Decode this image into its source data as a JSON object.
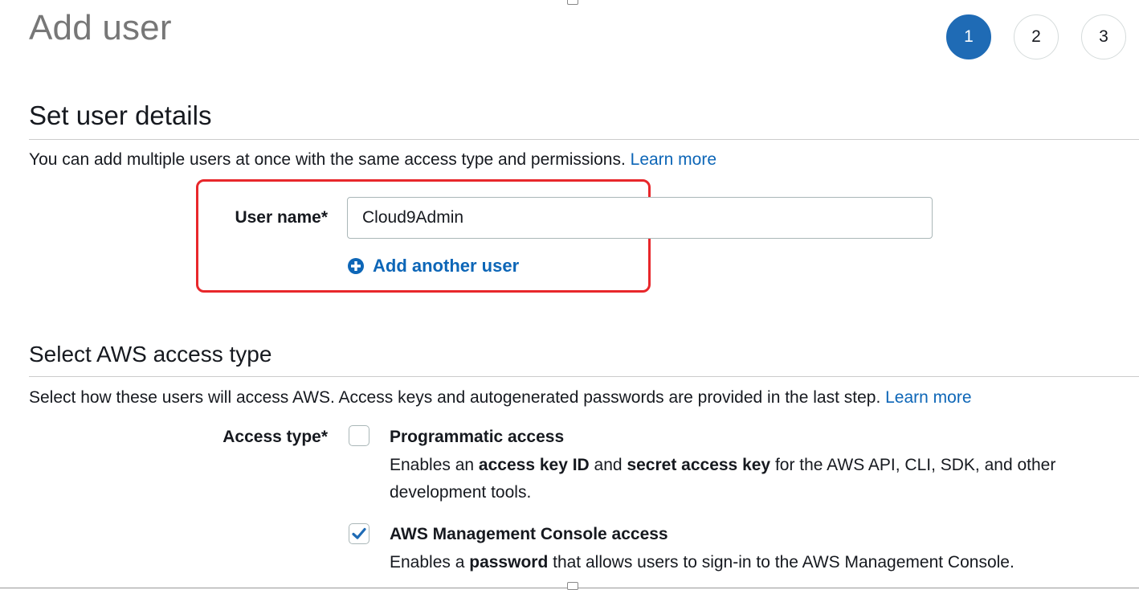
{
  "page": {
    "title": "Add user"
  },
  "steps": [
    {
      "label": "1",
      "active": true
    },
    {
      "label": "2",
      "active": false
    },
    {
      "label": "3",
      "active": false
    }
  ],
  "user_details": {
    "heading": "Set user details",
    "description": "You can add multiple users at once with the same access type and permissions.",
    "learn_more": "Learn more",
    "username_label": "User name*",
    "username_value": "Cloud9Admin",
    "add_another_label": "Add another user",
    "add_icon": "plus-circle-icon"
  },
  "access_type": {
    "heading": "Select AWS access type",
    "description": "Select how these users will access AWS. Access keys and autogenerated passwords are provided in the last step.",
    "learn_more": "Learn more",
    "label": "Access type*",
    "options": [
      {
        "title": "Programmatic access",
        "checked": false,
        "desc_parts": [
          "Enables an ",
          "access key ID",
          " and ",
          "secret access key",
          " for the AWS API, CLI, SDK, and other development tools."
        ]
      },
      {
        "title": "AWS Management Console access",
        "checked": true,
        "desc_parts": [
          "Enables a ",
          "password",
          " that allows users to sign-in to the AWS Management Console."
        ]
      }
    ]
  },
  "colors": {
    "accent": "#1f6bb5",
    "link": "#0d66b7",
    "highlight_border": "#e8272b",
    "title_gray": "#777777"
  }
}
